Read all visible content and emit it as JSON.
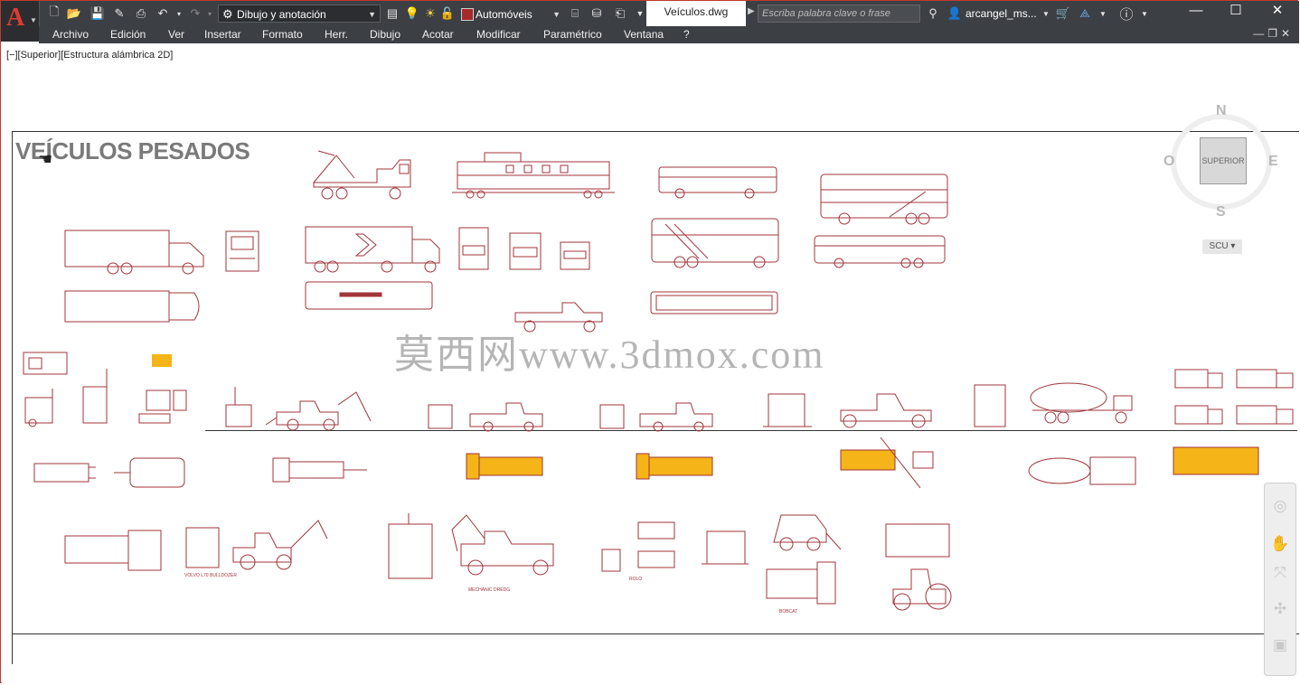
{
  "window": {
    "document_tab": "Veículos.dwg",
    "search_placeholder": "Escriba palabra clave o frase",
    "user": "arcangel_ms...",
    "minimize": "—",
    "maximize": "☐",
    "close": "✕"
  },
  "toolbar": {
    "workspace": "Dibujo y anotación",
    "layer": "Automóveis",
    "layer_color": "#a52a2a"
  },
  "menu": [
    "Archivo",
    "Edición",
    "Ver",
    "Insertar",
    "Formato",
    "Herr.",
    "Dibujo",
    "Acotar",
    "Modificar",
    "Paramétrico",
    "Ventana",
    "?"
  ],
  "viewport": {
    "label": "[−][Superior][Estructura alámbrica 2D]",
    "title": "VEÍCULOS PESADOS",
    "watermark": "莫西网www.3dmox.com"
  },
  "viewcube": {
    "north": "N",
    "south": "S",
    "east": "E",
    "west": "O",
    "face": "SUPERIOR",
    "ucs": "SCU ▾"
  },
  "drawing_labels": {
    "bulldozer": "VOLVO L70 BULLDOZER",
    "excavator": "MECHANIC DREDG",
    "roller": "ROLO",
    "loader": "BOBCAT"
  },
  "colors": {
    "line": "#a0353b",
    "highlight": "#f5b417",
    "titlebar": "#3c3f44"
  }
}
